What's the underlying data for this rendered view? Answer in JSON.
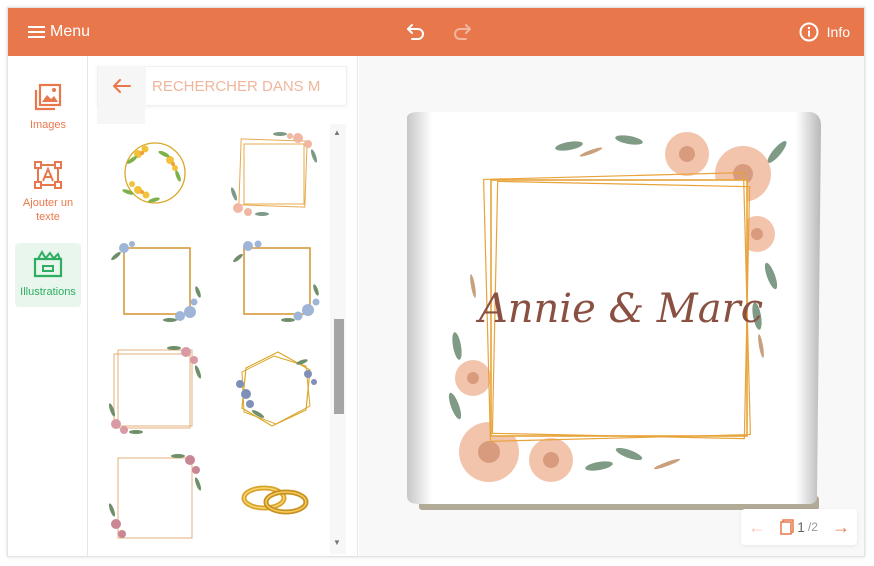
{
  "topbar": {
    "menu_label": "Menu",
    "info_label": "Info",
    "accent": "#e8784c"
  },
  "sidebar": {
    "items": [
      {
        "label": "Images",
        "icon": "images-icon"
      },
      {
        "label": "Ajouter un texte",
        "icon": "add-text-icon"
      },
      {
        "label": "Illustrations",
        "icon": "illustrations-icon",
        "active": true
      }
    ]
  },
  "panel": {
    "search_placeholder": "RECHERCHER DANS M",
    "illustrations": [
      {
        "name": "yellow-flower-wreath"
      },
      {
        "name": "peach-rose-gold-frame"
      },
      {
        "name": "blue-flower-frame-1"
      },
      {
        "name": "blue-flower-frame-2"
      },
      {
        "name": "pink-flower-double-frame"
      },
      {
        "name": "blue-flower-hexagon"
      },
      {
        "name": "pink-flower-square-frame"
      },
      {
        "name": "wedding-rings"
      }
    ]
  },
  "canvas": {
    "card_text": "Annie & Marc",
    "page_current": "1",
    "page_total": "/2"
  }
}
